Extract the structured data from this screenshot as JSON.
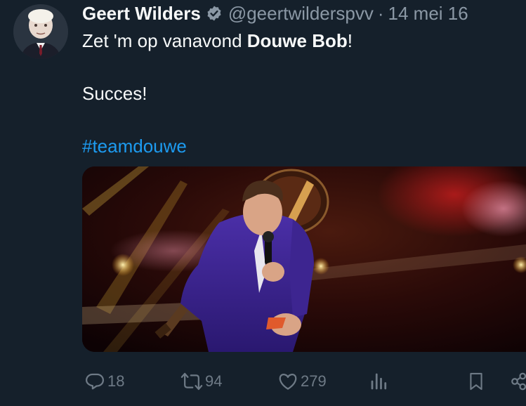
{
  "tweet": {
    "author_name": "Geert Wilders",
    "handle": "@geertwilderspvv",
    "separator": "·",
    "date": "14 mei 16",
    "line1_prefix": "Zet 'm op vanavond ",
    "line1_bold": "Douwe Bob",
    "line1_suffix": "!",
    "line2": "Succes!",
    "hashtag": "#teamdouwe"
  },
  "actions": {
    "replies": "18",
    "retweets": "94",
    "likes": "279"
  },
  "icons": {
    "verified": "verified-badge-icon",
    "reply": "reply-icon",
    "retweet": "retweet-icon",
    "like": "heart-icon",
    "views": "analytics-icon",
    "bookmark": "bookmark-icon",
    "share": "share-icon"
  },
  "colors": {
    "background": "#15202b",
    "text": "#f7f9f9",
    "secondary": "#8b98a5",
    "link": "#1d9bf0"
  }
}
